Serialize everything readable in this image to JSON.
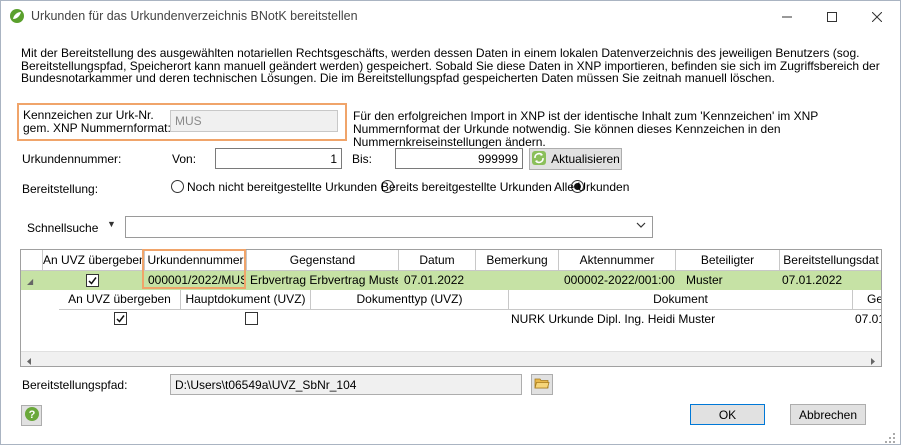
{
  "window": {
    "title": "Urkunden für das Urkundenverzeichnis BNotK bereitstellen",
    "icon": "app-leaf-icon",
    "controls": [
      "minimize-icon",
      "maximize-icon",
      "close-icon"
    ]
  },
  "intro_text": "Mit der Bereitstellung des ausgewählten notariellen Rechtsgeschäfts, werden dessen Daten in einem lokalen Datenverzeichnis des jeweiligen Benutzers (sog. Bereitstellungspfad, Speicherort kann manuell geändert werden) gespeichert. Sobald Sie diese Daten in XNP importieren, befinden sie sich im Zugriffsbereich der Bundesnotarkammer und deren technischen Lösungen. Die im Bereitstellungspfad gespeicherten Daten müssen Sie zeitnah manuell löschen.",
  "kennzeichen": {
    "label": "Kennzeichen zur Urk-Nr. gem. XNP Nummernformat:",
    "value": "MUS",
    "info": "Für den erfolgreichen Import in XNP ist der identische Inhalt zum 'Kennzeichen' im XNP Nummernformat der Urkunde notwendig. Sie können dieses Kennzeichen in den Nummernkreiseinstellungen ändern."
  },
  "urkundennummer": {
    "label": "Urkundennummer:",
    "von_label": "Von:",
    "von_value": "1",
    "bis_label": "Bis:",
    "bis_value": "999999",
    "refresh_label": "Aktualisieren",
    "refresh_icon": "refresh-icon"
  },
  "bereitstellung": {
    "label": "Bereitstellung:",
    "options": [
      "Noch nicht bereitgestellte Urkunden",
      "Bereits bereitgestellte Urkunden",
      "Alle Urkunden"
    ],
    "selected": "Alle Urkunden"
  },
  "schnellsuche": {
    "label": "Schnellsuche",
    "value": ""
  },
  "grid": {
    "columns": [
      "An UVZ übergeben",
      "Urkundennummer",
      "Gegenstand",
      "Datum",
      "Bemerkung",
      "Aktennummer",
      "Beteiligter",
      "Bereitstellungsdat"
    ],
    "row": {
      "an_uvz": true,
      "urkundennummer": "000001/2022/MUS",
      "gegenstand": "Erbvertrag Erbvertrag Muster",
      "datum": "07.01.2022",
      "bemerkung": "",
      "aktennummer": "000002-2022/001:00",
      "beteiligter": "Muster",
      "bereitstellungsdatum": "07.01.2022"
    },
    "sub_columns": [
      "An UVZ übergeben",
      "Hauptdokument (UVZ)",
      "Dokumenttyp (UVZ)",
      "Dokument",
      "Ge"
    ],
    "sub_row": {
      "an_uvz": true,
      "hauptdokument": false,
      "dokumenttyp": "",
      "dokument": "NURK Urkunde Dipl. Ing. Heidi Muster",
      "ge": "07.01"
    }
  },
  "pfad": {
    "label": "Bereitstellungspfad:",
    "value": "D:\\Users\\t06549a\\UVZ_SbNr_104",
    "browse_icon": "folder-open-icon"
  },
  "buttons": {
    "help_icon": "help-icon",
    "ok": "OK",
    "cancel": "Abbrechen"
  },
  "colors": {
    "accent_orange": "#f0a46a",
    "selected_row": "#c6e2a5"
  }
}
